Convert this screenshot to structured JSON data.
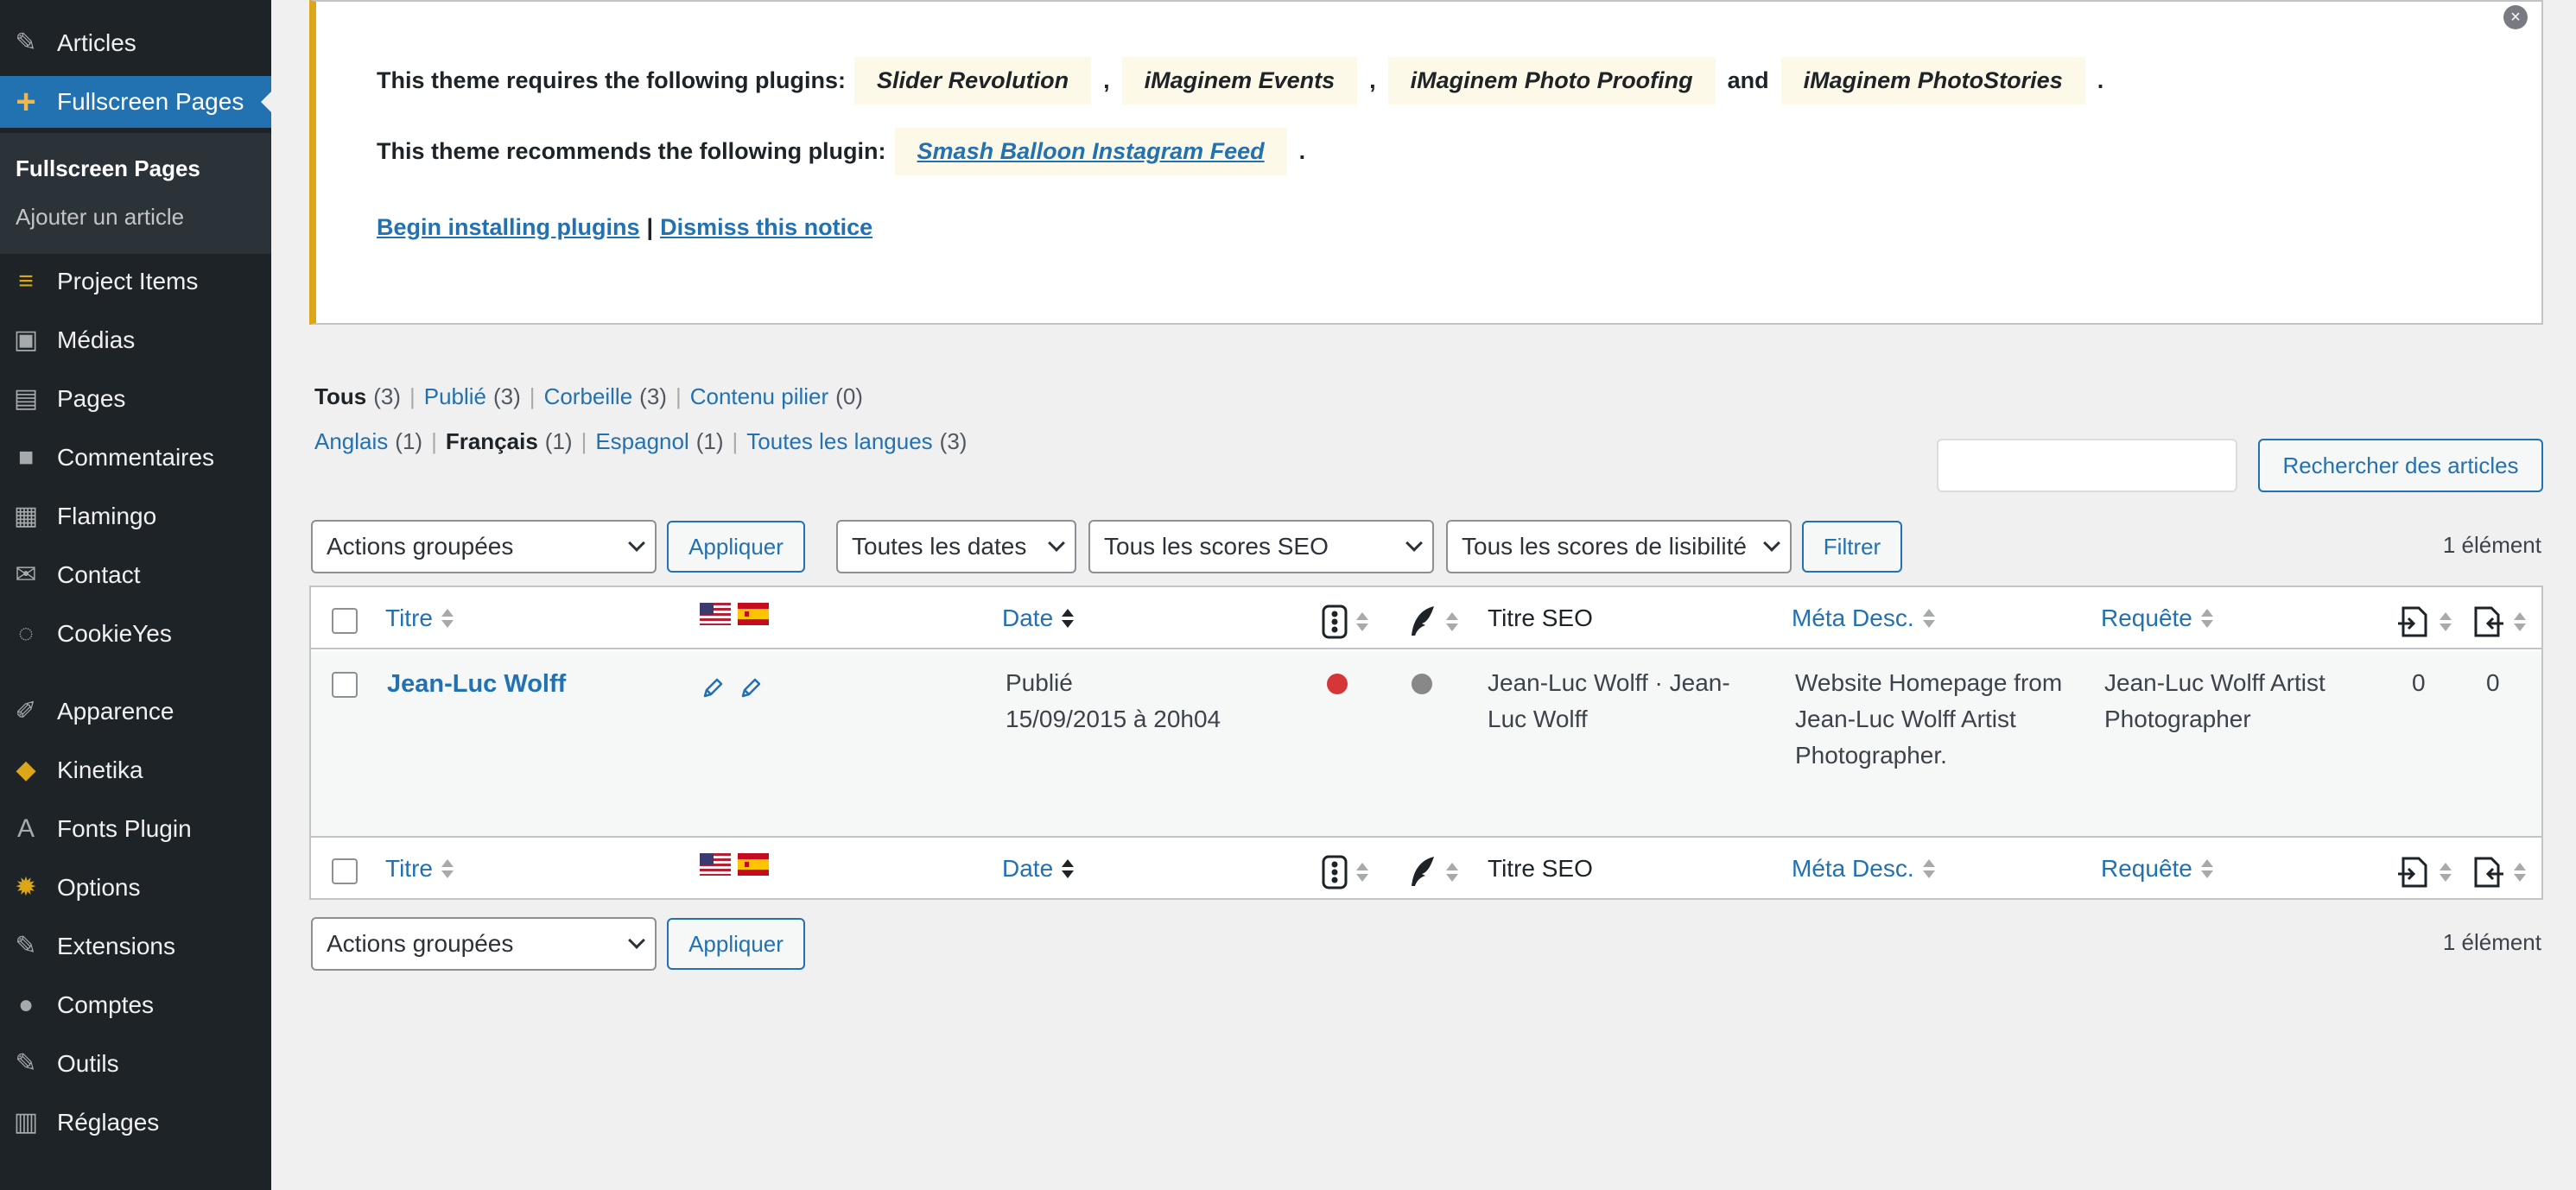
{
  "sidebar": {
    "items": [
      {
        "label": "Articles",
        "icon": "pin-icon"
      },
      {
        "label": "Fullscreen Pages",
        "icon": "plus-icon",
        "active": true
      },
      {
        "label": "Project Items",
        "icon": "list-icon"
      },
      {
        "label": "Médias",
        "icon": "media-icon"
      },
      {
        "label": "Pages",
        "icon": "pages-icon"
      },
      {
        "label": "Commentaires",
        "icon": "comment-icon"
      },
      {
        "label": "Flamingo",
        "icon": "feedback-icon"
      },
      {
        "label": "Contact",
        "icon": "mail-icon"
      },
      {
        "label": "CookieYes",
        "icon": "cookie-icon"
      },
      {
        "label": "Apparence",
        "icon": "brush-icon"
      },
      {
        "label": "Kinetika",
        "icon": "cube-icon"
      },
      {
        "label": "Fonts Plugin",
        "icon": "font-icon"
      },
      {
        "label": "Options",
        "icon": "gear-icon"
      },
      {
        "label": "Extensions",
        "icon": "plugin-icon"
      },
      {
        "label": "Comptes",
        "icon": "user-icon"
      },
      {
        "label": "Outils",
        "icon": "wrench-icon"
      },
      {
        "label": "Réglages",
        "icon": "settings-icon"
      }
    ],
    "submenu": [
      "Fullscreen Pages",
      "Ajouter un article"
    ],
    "active_color": "#2271b1",
    "icon_accent": "#f0b849"
  },
  "notice": {
    "required_prefix": "This theme requires the following plugins:",
    "required_plugins": [
      "Slider Revolution",
      "iMaginem Events",
      "iMaginem Photo Proofing",
      "iMaginem PhotoStories"
    ],
    "sep_comma": ",",
    "sep_and": "and",
    "end_dot": ".",
    "recommended_prefix": "This theme recommends the following plugin:",
    "recommended_plugin": "Smash Balloon Instagram Feed",
    "begin_link": "Begin installing plugins",
    "pipe": "|",
    "dismiss_link": "Dismiss this notice",
    "close_glyph": "×",
    "border_color": "#dba617"
  },
  "status_filters": [
    {
      "label": "Tous",
      "count": "(3)",
      "current": true
    },
    {
      "label": "Publié",
      "count": "(3)"
    },
    {
      "label": "Corbeille",
      "count": "(3)"
    },
    {
      "label": "Contenu pilier",
      "count": "(0)"
    }
  ],
  "language_filters": [
    {
      "label": "Anglais",
      "count": "(1)"
    },
    {
      "label": "Français",
      "count": "(1)",
      "current": true
    },
    {
      "label": "Espagnol",
      "count": "(1)"
    },
    {
      "label": "Toutes les langues",
      "count": "(3)"
    }
  ],
  "filter_sep": "|",
  "search": {
    "value": "",
    "button": "Rechercher des articles"
  },
  "bulk": {
    "label": "Actions groupées",
    "apply": "Appliquer"
  },
  "filters": {
    "dates": "Toutes les dates",
    "seo": "Tous les scores SEO",
    "readability": "Tous les scores de lisibilité",
    "button": "Filtrer"
  },
  "item_count": "1 élément",
  "table": {
    "columns": {
      "title": "Titre",
      "date": "Date",
      "seo_title": "Titre SEO",
      "meta": "Méta Desc.",
      "query": "Requête"
    },
    "row": {
      "title": "Jean-Luc Wolff",
      "status": "Publié",
      "date": "15/09/2015 à 20h04",
      "seo_score_color": "#d63638",
      "readability_color": "#888888",
      "seo_title": "Jean-Luc Wolff · Jean-Luc Wolff",
      "meta_desc": "Website Homepage from Jean-Luc Wolff Artist Photographer.",
      "query": "Jean-Luc Wolff Artist Photographer",
      "outgoing_links": "0",
      "incoming_links": "0"
    }
  }
}
